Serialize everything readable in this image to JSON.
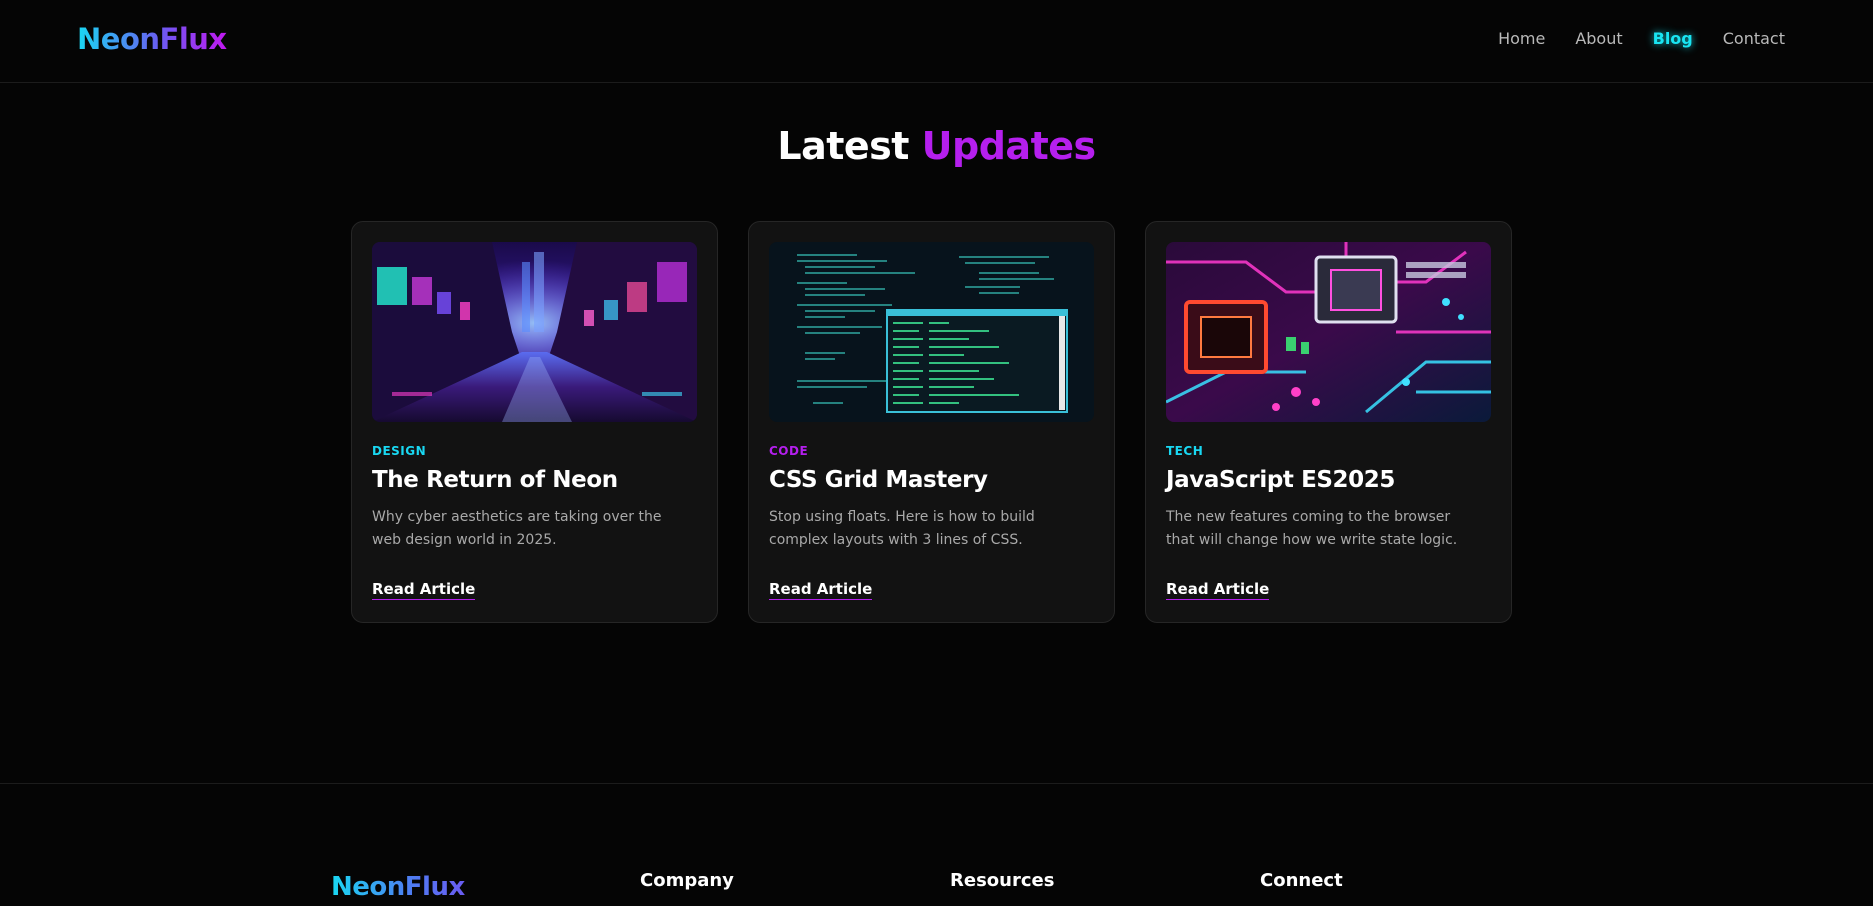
{
  "brand": {
    "name": "NeonFlux"
  },
  "nav": {
    "items": [
      {
        "label": "Home",
        "active": false
      },
      {
        "label": "About",
        "active": false
      },
      {
        "label": "Blog",
        "active": true
      },
      {
        "label": "Contact",
        "active": false
      }
    ]
  },
  "section": {
    "title_main": "Latest",
    "title_accent": "Updates"
  },
  "cards": [
    {
      "category": "DESIGN",
      "category_color": "#19d8f2",
      "title": "The Return of Neon",
      "excerpt": "Why cyber aesthetics are taking over the web design world in 2025.",
      "link_label": "Read Article",
      "image_icon": "neon-city-street-image"
    },
    {
      "category": "CODE",
      "category_color": "#b51fee",
      "title": "CSS Grid Mastery",
      "excerpt": "Stop using floats. Here is how to build complex layouts with 3 lines of CSS.",
      "link_label": "Read Article",
      "image_icon": "code-editor-image"
    },
    {
      "category": "TECH",
      "category_color": "#19d8f2",
      "title": "JavaScript ES2025",
      "excerpt": "The new features coming to the browser that will change how we write state logic.",
      "link_label": "Read Article",
      "image_icon": "circuit-board-image"
    }
  ],
  "footer": {
    "brand": "NeonFlux",
    "columns": [
      {
        "heading": "Company"
      },
      {
        "heading": "Resources"
      },
      {
        "heading": "Connect"
      }
    ]
  },
  "colors": {
    "background": "#050505",
    "card": "#121212",
    "cyan": "#19e4f2",
    "purple": "#b51fee"
  }
}
